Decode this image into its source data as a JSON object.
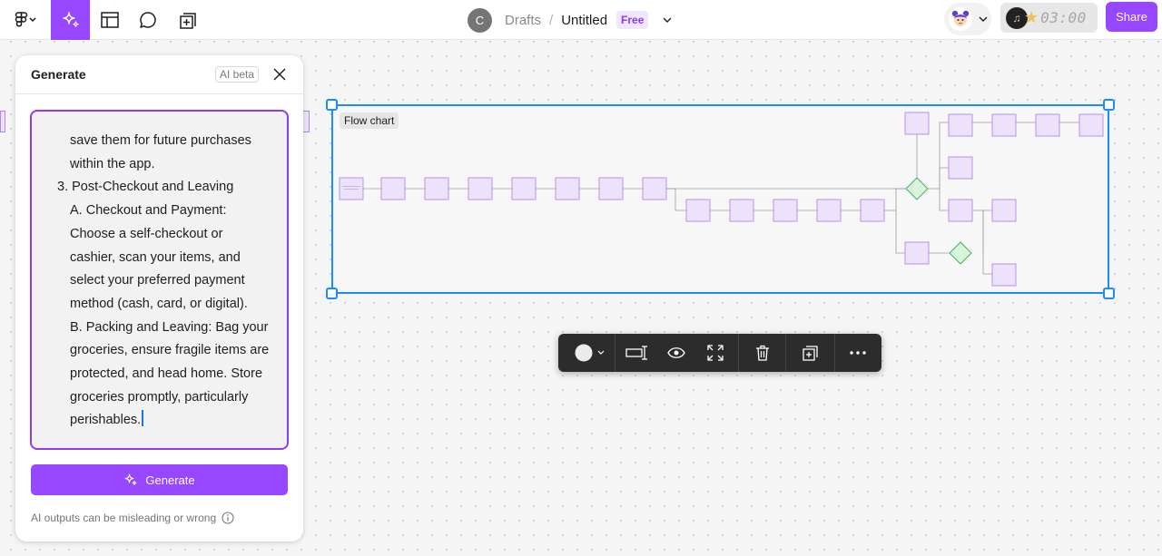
{
  "topbar": {
    "breadcrumb": {
      "avatar_initial": "C",
      "drafts": "Drafts",
      "separator": "/",
      "title": "Untitled",
      "plan_badge": "Free"
    },
    "timer": "03:00",
    "share_label": "Share",
    "icons": [
      "figma-logo-icon",
      "ai-sparkle-icon",
      "layout-icon",
      "comment-icon",
      "add-frame-icon",
      "chevron-down-icon",
      "music-icon",
      "star-icon"
    ]
  },
  "panel": {
    "title": "Generate",
    "badge": "AI beta",
    "prompt_lines": [
      {
        "text": "save them for future purchases",
        "indent": true
      },
      {
        "text": "within the app.",
        "indent": true
      },
      {
        "text": "3. Post-Checkout and Leaving",
        "indent": false
      },
      {
        "text": "A. Checkout and Payment:",
        "indent": true
      },
      {
        "text": "Choose a self-checkout or",
        "indent": true
      },
      {
        "text": "cashier, scan your items, and",
        "indent": true
      },
      {
        "text": "select your preferred payment",
        "indent": true
      },
      {
        "text": "method (cash, card, or digital).",
        "indent": true
      },
      {
        "text": "B. Packing and Leaving: Bag your",
        "indent": true
      },
      {
        "text": "groceries, ensure fragile items are",
        "indent": true
      },
      {
        "text": "protected, and head home. Store",
        "indent": true
      },
      {
        "text": "groceries promptly, particularly",
        "indent": true
      },
      {
        "text": "perishables.",
        "indent": true
      }
    ],
    "generate_label": "Generate",
    "footer": "AI outputs can be misleading or wrong"
  },
  "canvas": {
    "frame_label": "Flow chart"
  },
  "toolbar": {
    "fill_color": "#ececec",
    "tools": [
      "color-picker",
      "resize-icon",
      "eye-icon",
      "expand-icon",
      "trash-icon",
      "duplicate-icon",
      "more-icon"
    ]
  },
  "colors": {
    "accent": "#9747ff",
    "selection": "#1a8cff",
    "node_fill": "#ede2fb",
    "node_stroke": "#b188e6",
    "decision_fill": "#d8f5dc",
    "decision_stroke": "#39a854"
  }
}
